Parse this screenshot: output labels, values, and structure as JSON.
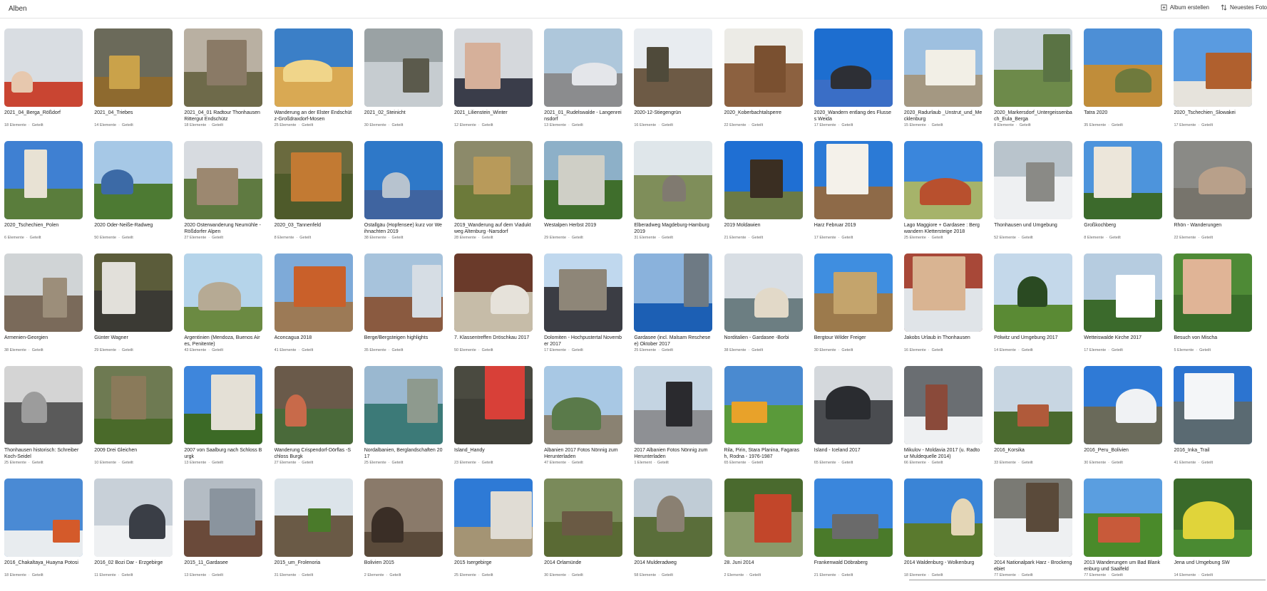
{
  "header": {
    "title": "Alben",
    "create_album": "Album erstellen",
    "newest_photo": "Neuestes Foto"
  },
  "albums": [
    {
      "name": "2021_04_Berga_Rößdorf",
      "meta": "18 Elemente",
      "shared": "Geteilt",
      "sky": "#d9dde2",
      "ground": "#c94532",
      "obj": "#e7c8ae"
    },
    {
      "name": "2021_04_Triebes",
      "meta": "14 Elemente",
      "shared": "Geteilt",
      "sky": "#6b6a5a",
      "ground": "#8e6a2f",
      "obj": "#caa24a"
    },
    {
      "name": "2021_04_01 Radtour Thonhausen Rittergut Endschütz",
      "meta": "18 Elemente",
      "shared": "Geteilt",
      "sky": "#b9b0a2",
      "ground": "#6e6a4a",
      "obj": "#8a7a66"
    },
    {
      "name": "Wanderung an der Elster Endschütz-Großdraxdorf-Mosen",
      "meta": "25 Elemente",
      "shared": "Geteilt",
      "sky": "#3b7fc7",
      "ground": "#d9a953",
      "obj": "#f0d58a"
    },
    {
      "name": "2021_02_Steinicht",
      "meta": "30 Elemente",
      "shared": "Geteilt",
      "sky": "#9aa2a4",
      "ground": "#c6ccd0",
      "obj": "#5b5a4c"
    },
    {
      "name": "2021_Lilienstein_Winter",
      "meta": "12 Elemente",
      "shared": "Geteilt",
      "sky": "#d5d8dc",
      "ground": "#3a3d4a",
      "obj": "#d6b09a"
    },
    {
      "name": "2021_01_Rudelswalde - Langenreinsdorf",
      "meta": "13 Elemente",
      "shared": "Geteilt",
      "sky": "#aec7db",
      "ground": "#8b8c8e",
      "obj": "#e4e6ea"
    },
    {
      "name": "2020-12-Stiegengrün",
      "meta": "16 Elemente",
      "shared": "Geteilt",
      "sky": "#e8ecf0",
      "ground": "#6d5a45",
      "obj": "#4f4a3a"
    },
    {
      "name": "2020_Koberbachtalsperre",
      "meta": "22 Elemente",
      "shared": "Geteilt",
      "sky": "#ecebe6",
      "ground": "#8c6140",
      "obj": "#7a5030"
    },
    {
      "name": "2020_Wandern entlang des Flusses Weida",
      "meta": "17 Elemente",
      "shared": "Geteilt",
      "sky": "#1d6ed0",
      "ground": "#3a6ec6",
      "obj": "#2d2f35"
    },
    {
      "name": "2020_Radurlaub _Unstrut_und_Mecklenburg",
      "meta": "15 Elemente",
      "shared": "Geteilt",
      "sky": "#9ec0e0",
      "ground": "#a49882",
      "obj": "#f2efe6"
    },
    {
      "name": "2020_Markersdorf_Untergeissenbach_Eula_Berga",
      "meta": "8 Elemente",
      "shared": "Geteilt",
      "sky": "#c9d4dc",
      "ground": "#6d8a4a",
      "obj": "#5a7344"
    },
    {
      "name": "Tatra 2020",
      "meta": "35 Elemente",
      "shared": "Geteilt",
      "sky": "#4d8fd6",
      "ground": "#c08d3a",
      "obj": "#6f7a3d"
    },
    {
      "name": "2020_Tschechien_Slowakei",
      "meta": "17 Elemente",
      "shared": "Geteilt",
      "sky": "#5a9be0",
      "ground": "#e6e3dc",
      "obj": "#b0602e"
    },
    {
      "name": "2020_Tschechien_Polen",
      "meta": "6 Elemente",
      "shared": "Geteilt",
      "sky": "#3f80d2",
      "ground": "#5a7d3c",
      "obj": "#e8e2d4"
    },
    {
      "name": "2020 Oder-Neiße-Radweg",
      "meta": "50 Elemente",
      "shared": "Geteilt",
      "sky": "#a6c8e6",
      "ground": "#4d7a33",
      "obj": "#3c6aa6"
    },
    {
      "name": "2020 Osterwanderung Neumühle -Rößdorfer Alpen",
      "meta": "27 Elemente",
      "shared": "Geteilt",
      "sky": "#d7dbe0",
      "ground": "#5f7a41",
      "obj": "#9c8870"
    },
    {
      "name": "2020_03_Tannenfeld",
      "meta": "8 Elemente",
      "shared": "Geteilt",
      "sky": "#6a6a3e",
      "ground": "#4e5a2a",
      "obj": "#c27a33"
    },
    {
      "name": "Ostallgäu (Hopfensee) kurz vor Weihnachten 2019",
      "meta": "38 Elemente",
      "shared": "Geteilt",
      "sky": "#2e78c8",
      "ground": "#3f64a0",
      "obj": "#b7c3cf"
    },
    {
      "name": "2019_Wanderung auf dem Viaduktweg Altenburg -Narsdorf",
      "meta": "28 Elemente",
      "shared": "Geteilt",
      "sky": "#8c8a6a",
      "ground": "#6c7a3a",
      "obj": "#b89a5a"
    },
    {
      "name": "Westalpen Herbst 2019",
      "meta": "29 Elemente",
      "shared": "Geteilt",
      "sky": "#8db0c8",
      "ground": "#3f6e2c",
      "obj": "#cfcfc6"
    },
    {
      "name": "Elberadweg Magdeburg-Hamburg 2019",
      "meta": "31 Elemente",
      "shared": "Geteilt",
      "sky": "#dfe6ea",
      "ground": "#7f8e5a",
      "obj": "#807a70"
    },
    {
      "name": "2019 Moldawien",
      "meta": "21 Elemente",
      "shared": "Geteilt",
      "sky": "#1f6fd3",
      "ground": "#6b7a46",
      "obj": "#3a2e22"
    },
    {
      "name": "Harz Februar 2019",
      "meta": "17 Elemente",
      "shared": "Geteilt",
      "sky": "#2b7ad6",
      "ground": "#8e6a48",
      "obj": "#f4f1ea"
    },
    {
      "name": "Lago Maggiore + Gardasee : Bergwandern Klettersteige 2018",
      "meta": "25 Elemente",
      "shared": "Geteilt",
      "sky": "#3a86dc",
      "ground": "#a6b36a",
      "obj": "#b8502e"
    },
    {
      "name": "Thonhausen und Umgebung",
      "meta": "52 Elemente",
      "shared": "Geteilt",
      "sky": "#b9c4cc",
      "ground": "#eef0f2",
      "obj": "#8a8a86"
    },
    {
      "name": "Großkochberg",
      "meta": "8 Elemente",
      "shared": "Geteilt",
      "sky": "#4d94dc",
      "ground": "#3c6a2c",
      "obj": "#ece6da"
    },
    {
      "name": "Rhön - Wanderungen",
      "meta": "22 Elemente",
      "shared": "Geteilt",
      "sky": "#8a8a86",
      "ground": "#77746c",
      "obj": "#b8a08a"
    },
    {
      "name": "Armenien-Georgien",
      "meta": "38 Elemente",
      "shared": "Geteilt",
      "sky": "#d0d4d6",
      "ground": "#7a6a5a",
      "obj": "#9c8e7a"
    },
    {
      "name": "Günter Wagner",
      "meta": "29 Elemente",
      "shared": "Geteilt",
      "sky": "#5b5c3a",
      "ground": "#3b3a34",
      "obj": "#e2e0da"
    },
    {
      "name": "Argentinien (Mendoza, Buenos Aires, Penitente)",
      "meta": "43 Elemente",
      "shared": "Geteilt",
      "sky": "#b5d4ea",
      "ground": "#6b8a42",
      "obj": "#b6aa94"
    },
    {
      "name": "Aconcagua 2018",
      "meta": "41 Elemente",
      "shared": "Geteilt",
      "sky": "#7eaad8",
      "ground": "#9c7a56",
      "obj": "#c9602a"
    },
    {
      "name": "Berge/Bergsteigen highlights",
      "meta": "35 Elemente",
      "shared": "Geteilt",
      "sky": "#a7c3dc",
      "ground": "#8a5a40",
      "obj": "#d6dde4"
    },
    {
      "name": "7. Klassentreffen Dröschkau 2017",
      "meta": "50 Elemente",
      "shared": "Geteilt",
      "sky": "#6a3a2a",
      "ground": "#c6bca8",
      "obj": "#e6e2da"
    },
    {
      "name": "Dolomiten - Hochpustertal November 2017",
      "meta": "17 Elemente",
      "shared": "Geteilt",
      "sky": "#c0d8ee",
      "ground": "#3b3d44",
      "obj": "#8e8678"
    },
    {
      "name": "Gardasee (incl. Malsam Reschesee) Oktober 2017",
      "meta": "25 Elemente",
      "shared": "Geteilt",
      "sky": "#8ab2dc",
      "ground": "#1c5fb4",
      "obj": "#6e7a84"
    },
    {
      "name": "Norditalien - Gardasee -Borbi",
      "meta": "38 Elemente",
      "shared": "Geteilt",
      "sky": "#d8dee4",
      "ground": "#6c7e82",
      "obj": "#e2d9c8"
    },
    {
      "name": "Bergtour Wilder Freiger",
      "meta": "30 Elemente",
      "shared": "Geteilt",
      "sky": "#3f8ee0",
      "ground": "#9c7a4c",
      "obj": "#c4a46c"
    },
    {
      "name": "Jakobs Urlaub in Thonhausen",
      "meta": "16 Elemente",
      "shared": "Geteilt",
      "sky": "#a84838",
      "ground": "#e0e4e8",
      "obj": "#d9b492"
    },
    {
      "name": "Pölwitz und Umgebung 2017",
      "meta": "14 Elemente",
      "shared": "Geteilt",
      "sky": "#c4d8ea",
      "ground": "#5a8a34",
      "obj": "#2a4a22"
    },
    {
      "name": "Wetteiswalde Kirche 2017",
      "meta": "17 Elemente",
      "shared": "Geteilt",
      "sky": "#b6cce0",
      "ground": "#3b6a2c",
      "obj": "#ffffff"
    },
    {
      "name": "Besuch von Mischa",
      "meta": "5 Elemente",
      "shared": "Geteilt",
      "sky": "#4e8a36",
      "ground": "#3a6e2a",
      "obj": "#e0b496"
    },
    {
      "name": "Thonhausen historisch: Schreiber Koch-Seidel",
      "meta": "25 Elemente",
      "shared": "Geteilt",
      "sky": "#d4d4d4",
      "ground": "#5a5a5a",
      "obj": "#9c9c9c"
    },
    {
      "name": "2009 Drei Gleichen",
      "meta": "10 Elemente",
      "shared": "Geteilt",
      "sky": "#6e7a52",
      "ground": "#4a6a2a",
      "obj": "#8a7a5a"
    },
    {
      "name": "2007 von Saalburg nach Schloss Burgk",
      "meta": "13 Elemente",
      "shared": "Geteilt",
      "sky": "#3e86dc",
      "ground": "#3c6a26",
      "obj": "#e4e0d6"
    },
    {
      "name": "Wanderung Crispendorf-Dörflas -Schloss Burgk",
      "meta": "27 Elemente",
      "shared": "Geteilt",
      "sky": "#6a5a4a",
      "ground": "#4a6a3a",
      "obj": "#c86a4a"
    },
    {
      "name": "Nordalbanien, Berglandschaften 2017",
      "meta": "25 Elemente",
      "shared": "Geteilt",
      "sky": "#9ab8d0",
      "ground": "#3c7a78",
      "obj": "#8e9a8e"
    },
    {
      "name": "Island_Handy",
      "meta": "23 Elemente",
      "shared": "Geteilt",
      "sky": "#4a4a40",
      "ground": "#3e3e36",
      "obj": "#d84038"
    },
    {
      "name": "Albanien 2017 Fotos Nönnig zum Herunterladen",
      "meta": "47 Elemente",
      "shared": "Geteilt",
      "sky": "#a8c8e4",
      "ground": "#8a8272",
      "obj": "#5a7a4a"
    },
    {
      "name": "2017 Albanien Fotos Nönnig zum Herunterladen",
      "meta": "1 Element",
      "shared": "Geteilt",
      "sky": "#c4d4e2",
      "ground": "#8e9094",
      "obj": "#2a2a2e"
    },
    {
      "name": "Rila, Pirin, Stara Planina, Fagarash, Rodna - 1976-1987",
      "meta": "65 Elemente",
      "shared": "Geteilt",
      "sky": "#4a8ad0",
      "ground": "#5a9a3a",
      "obj": "#e8a22a"
    },
    {
      "name": "Island - Iceland 2017",
      "meta": "65 Elemente",
      "shared": "Geteilt",
      "sky": "#d4d8dc",
      "ground": "#4a4c50",
      "obj": "#2a2c30"
    },
    {
      "name": "Mikulov - Moldavia 2017 (u. Radtour Muldequelle 2014)",
      "meta": "66 Elemente",
      "shared": "Geteilt",
      "sky": "#6a6e72",
      "ground": "#eef0f2",
      "obj": "#8a4a3a"
    },
    {
      "name": "2016_Korsika",
      "meta": "33 Elemente",
      "shared": "Geteilt",
      "sky": "#c8d6e2",
      "ground": "#4a6a2e",
      "obj": "#b05a3a"
    },
    {
      "name": "2016_Peru_Bolivien",
      "meta": "30 Elemente",
      "shared": "Geteilt",
      "sky": "#2f7ad6",
      "ground": "#6a6a5a",
      "obj": "#f0f2f4"
    },
    {
      "name": "2016_Inka_Trail",
      "meta": "41 Elemente",
      "shared": "Geteilt",
      "sky": "#2c74d0",
      "ground": "#5a6a72",
      "obj": "#f4f6f8"
    },
    {
      "name": "2016_Chakaltaya_Huayna Potosi",
      "meta": "18 Elemente",
      "shared": "Geteilt",
      "sky": "#4a8ad4",
      "ground": "#e8ecef",
      "obj": "#d45a2a"
    },
    {
      "name": "2016_02 Bozi Dar - Erzgebirge",
      "meta": "11 Elemente",
      "shared": "Geteilt",
      "sky": "#c8d0d8",
      "ground": "#eef0f2",
      "obj": "#3a3e46"
    },
    {
      "name": "2015_11_Gardasee",
      "meta": "13 Elemente",
      "shared": "Geteilt",
      "sky": "#b4bcc4",
      "ground": "#6a4a3a",
      "obj": "#8a949e"
    },
    {
      "name": "2015_um_Frolenoria",
      "meta": "31 Elemente",
      "shared": "Geteilt",
      "sky": "#dce4ea",
      "ground": "#6a5a46",
      "obj": "#4a7a2a"
    },
    {
      "name": "Bolivien 2015",
      "meta": "2 Elemente",
      "shared": "Geteilt",
      "sky": "#8a7a6a",
      "ground": "#5a4a3a",
      "obj": "#3a2e26"
    },
    {
      "name": "2015 Isergebirge",
      "meta": "25 Elemente",
      "shared": "Geteilt",
      "sky": "#2e7ad6",
      "ground": "#a49474",
      "obj": "#e0dcd4"
    },
    {
      "name": "2014 Orlamünde",
      "meta": "30 Elemente",
      "shared": "Geteilt",
      "sky": "#7a8a5a",
      "ground": "#5a6a34",
      "obj": "#6a5a44"
    },
    {
      "name": "2014 Mulderadweg",
      "meta": "58 Elemente",
      "shared": "Geteilt",
      "sky": "#c0ccd6",
      "ground": "#5a6e3a",
      "obj": "#8a8072"
    },
    {
      "name": "28. Juni 2014",
      "meta": "2 Elemente",
      "shared": "Geteilt",
      "sky": "#4a6a2e",
      "ground": "#8a9a6a",
      "obj": "#c2462a"
    },
    {
      "name": "Frankenwald Döbraberg",
      "meta": "21 Elemente",
      "shared": "Geteilt",
      "sky": "#3a86dc",
      "ground": "#4a7a2a",
      "obj": "#6a6a6a"
    },
    {
      "name": "2014 Waldenburg - Wolkenburg",
      "meta": "18 Elemente",
      "shared": "Geteilt",
      "sky": "#3a84d6",
      "ground": "#5a7a2e",
      "obj": "#e4d6b6"
    },
    {
      "name": "2014 Nationalpark Harz - Brockengebiet",
      "meta": "77 Elemente",
      "shared": "Geteilt",
      "sky": "#7a7a74",
      "ground": "#eef0f2",
      "obj": "#5a4a3a"
    },
    {
      "name": "2013 Wanderungen um Bad Blankenburg und Saalfeld",
      "meta": "77 Elemente",
      "shared": "Geteilt",
      "sky": "#5a9ee0",
      "ground": "#4a8a2a",
      "obj": "#c85a3a"
    },
    {
      "name": "Jena und Umgebung SW",
      "meta": "14 Elemente",
      "shared": "Geteilt",
      "sky": "#3a6a2a",
      "ground": "#4a8a32",
      "obj": "#e0d43a"
    }
  ]
}
